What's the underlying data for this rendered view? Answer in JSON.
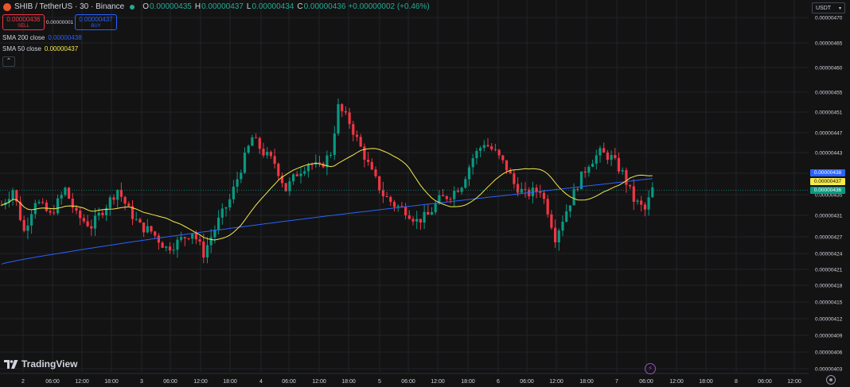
{
  "header": {
    "symbol": "SHIB / TetherUS · 30 · Binance",
    "ohlc": [
      {
        "label": "O",
        "value": "0.00000435"
      },
      {
        "label": "H",
        "value": "0.00000437"
      },
      {
        "label": "L",
        "value": "0.00000434"
      },
      {
        "label": "C",
        "value": "0.00000436"
      }
    ],
    "change": "+0.00000002 (+0.46%)"
  },
  "trade": {
    "sell_price": "0.00000436",
    "sell_label": "SELL",
    "spread": "0.00000001",
    "buy_price": "0.00000437",
    "buy_label": "BUY"
  },
  "indicators": [
    {
      "name": "SMA 200 close",
      "value": "0.00000438",
      "color": "#2962ff"
    },
    {
      "name": "SMA 50 close",
      "value": "0.00000437",
      "color": "#f5e94a"
    }
  ],
  "collapse_icon": "chevron-up-icon",
  "currency": {
    "label": "USDT"
  },
  "price_axis": {
    "ticks": [
      "0.00000470",
      "0.00000465",
      "0.00000460",
      "0.00000455",
      "0.00000451",
      "0.00000447",
      "0.00000443",
      "0.00000439",
      "0.00000435",
      "0.00000431",
      "0.00000427",
      "0.00000424",
      "0.00000421",
      "0.00000418",
      "0.00000415",
      "0.00000412",
      "0.00000409",
      "0.00000406",
      "0.00000403"
    ],
    "tags": [
      {
        "value": "0.00000438",
        "color": "#2962ff"
      },
      {
        "value": "0.00000437",
        "color": "#f5e94a"
      },
      {
        "value": "0.00000436",
        "color": "#089981"
      }
    ]
  },
  "time_axis": {
    "ticks": [
      "2",
      "06:00",
      "12:00",
      "18:00",
      "3",
      "06:00",
      "12:00",
      "18:00",
      "4",
      "06:00",
      "12:00",
      "18:00",
      "5",
      "06:00",
      "12:00",
      "18:00",
      "6",
      "06:00",
      "12:00",
      "18:00",
      "7",
      "06:00",
      "12:00",
      "18:00",
      "8",
      "06:00",
      "12:00"
    ]
  },
  "brand": "TradingView",
  "colors": {
    "up": "#089981",
    "down": "#f23645",
    "sma200": "#2962ff",
    "sma50": "#f5e94a",
    "background": "#131314",
    "grid": "#222327"
  },
  "chart_data": {
    "type": "candlestick",
    "title": "SHIB / TetherUS · 30 · Binance",
    "ylim": [
      4.03e-06,
      4.7e-06
    ],
    "yticks": [
      4.7e-06,
      4.65e-06,
      4.6e-06,
      4.55e-06,
      4.51e-06,
      4.47e-06,
      4.43e-06,
      4.39e-06,
      4.35e-06,
      4.31e-06,
      4.27e-06,
      4.24e-06,
      4.21e-06,
      4.18e-06,
      4.15e-06,
      4.12e-06,
      4.09e-06,
      4.06e-06,
      4.03e-06
    ],
    "interval": "30m",
    "series": [
      {
        "name": "SMA 200 close",
        "last": 4.38e-06
      },
      {
        "name": "SMA 50 close",
        "last": 4.37e-06
      }
    ],
    "price_path": [
      [
        0,
        4.33e-06
      ],
      [
        3,
        4.36e-06
      ],
      [
        6,
        4.28e-06
      ],
      [
        9,
        4.34e-06
      ],
      [
        13,
        4.31e-06
      ],
      [
        17,
        4.36e-06
      ],
      [
        20,
        4.31e-06
      ],
      [
        24,
        4.29e-06
      ],
      [
        28,
        4.33e-06
      ],
      [
        31,
        4.36e-06
      ],
      [
        34,
        4.32e-06
      ],
      [
        37,
        4.29e-06
      ],
      [
        40,
        4.28e-06
      ],
      [
        44,
        4.25e-06
      ],
      [
        47,
        4.26e-06
      ],
      [
        51,
        4.28e-06
      ],
      [
        54,
        4.24e-06
      ],
      [
        58,
        4.3e-06
      ],
      [
        61,
        4.34e-06
      ],
      [
        64,
        4.4e-06
      ],
      [
        67,
        4.46e-06
      ],
      [
        70,
        4.43e-06
      ],
      [
        73,
        4.41e-06
      ],
      [
        76,
        4.36e-06
      ],
      [
        79,
        4.39e-06
      ],
      [
        82,
        4.41e-06
      ],
      [
        85,
        4.4e-06
      ],
      [
        88,
        4.43e-06
      ],
      [
        90,
        4.52e-06
      ],
      [
        93,
        4.49e-06
      ],
      [
        96,
        4.44e-06
      ],
      [
        99,
        4.39e-06
      ],
      [
        102,
        4.35e-06
      ],
      [
        105,
        4.33e-06
      ],
      [
        108,
        4.32e-06
      ],
      [
        111,
        4.3e-06
      ],
      [
        114,
        4.31e-06
      ],
      [
        117,
        4.34e-06
      ],
      [
        120,
        4.35e-06
      ],
      [
        123,
        4.37e-06
      ],
      [
        126,
        4.42e-06
      ],
      [
        129,
        4.45e-06
      ],
      [
        132,
        4.43e-06
      ],
      [
        135,
        4.4e-06
      ],
      [
        137,
        4.37e-06
      ],
      [
        140,
        4.35e-06
      ],
      [
        144,
        4.36e-06
      ],
      [
        146,
        4.32e-06
      ],
      [
        148,
        4.27e-06
      ],
      [
        151,
        4.32e-06
      ],
      [
        154,
        4.37e-06
      ],
      [
        157,
        4.41e-06
      ],
      [
        160,
        4.43e-06
      ],
      [
        163,
        4.42e-06
      ],
      [
        166,
        4.39e-06
      ],
      [
        169,
        4.34e-06
      ],
      [
        172,
        4.32e-06
      ],
      [
        174,
        4.36e-06
      ]
    ]
  }
}
